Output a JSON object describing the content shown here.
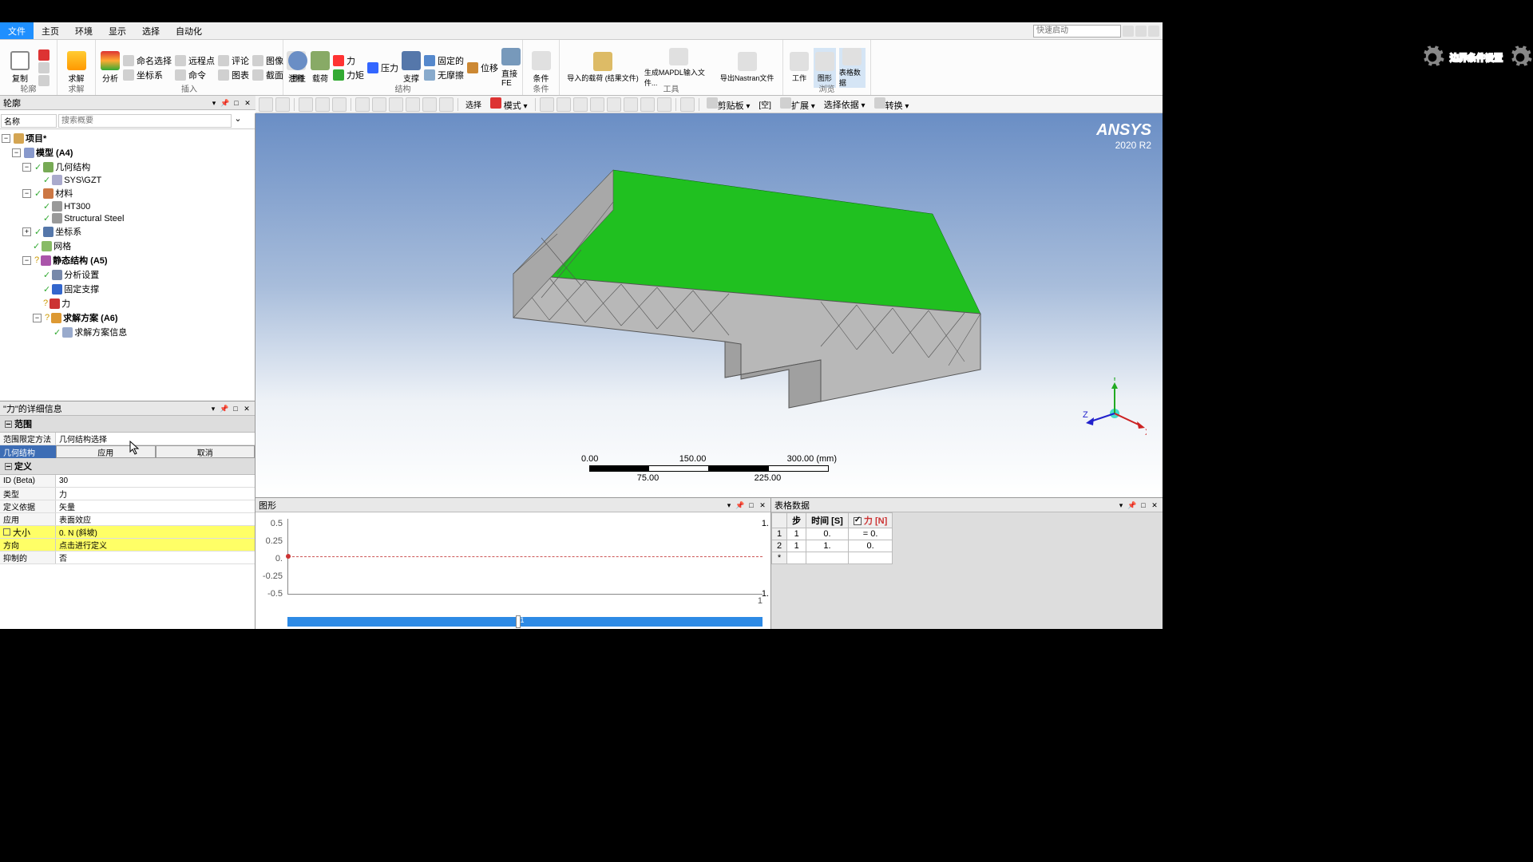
{
  "menubar": {
    "file": "文件",
    "home": "主页",
    "env": "环境",
    "display": "显示",
    "select": "选择",
    "auto": "自动化"
  },
  "quick": {
    "placeholder": "快速启动"
  },
  "ribbon": {
    "g1": {
      "copy": "复制",
      "label": "轮廓"
    },
    "g2": {
      "solve": "求解",
      "label": "求解"
    },
    "g3": {
      "analyze": "分析",
      "name_sel": "命名选择",
      "remote_pt": "远程点",
      "comment": "评论",
      "image": "图像",
      "coord": "坐标系",
      "cmd": "命令",
      "chart": "图表",
      "section": "截面",
      "annot": "注释",
      "label": "插入"
    },
    "g4": {
      "inertia": "惯性",
      "load": "载荷",
      "force": "力",
      "pressure": "压力",
      "moment": "力矩",
      "support": "支撑",
      "fixed": "固定的",
      "disp": "位移",
      "frictionless": "无摩擦",
      "direct": "直接FE",
      "label": "结构"
    },
    "g5": {
      "cond": "条件",
      "label": "条件"
    },
    "g6": {
      "import": "导入的载荷 (结果文件)",
      "mapdl": "生成MAPDL输入文件...",
      "nastran": "导出Nastran文件",
      "label": "工具"
    },
    "g7": {
      "sheet": "工作",
      "shape": "图形",
      "table": "表格数据",
      "label": "浏览"
    }
  },
  "toolbar2": {
    "select": "选择",
    "mode": "模式",
    "clipboard": "剪贴板",
    "empty": "[空]",
    "extend": "扩展",
    "sel_dep": "选择依据",
    "convert": "转换"
  },
  "outline": {
    "title": "轮廓",
    "filter_name": "名称",
    "search_placeholder": "搜索概要",
    "project": "项目*",
    "model": "模型 (A4)",
    "geometry": "几何结构",
    "body": "SYS\\GZT",
    "materials": "材料",
    "ht300": "HT300",
    "steel": "Structural Steel",
    "coord": "坐标系",
    "mesh": "网格",
    "static": "静态结构 (A5)",
    "settings": "分析设置",
    "fixed_sup": "固定支撑",
    "force": "力",
    "solution": "求解方案 (A6)",
    "sol_info": "求解方案信息"
  },
  "details": {
    "title": "\"力\"的详细信息",
    "scope_hdr": "范围",
    "scope_method_lbl": "范围限定方法",
    "scope_method_val": "几何结构选择",
    "geometry_lbl": "几何结构",
    "apply_btn": "应用",
    "cancel_btn": "取消",
    "def_hdr": "定义",
    "id_lbl": "ID (Beta)",
    "id_val": "30",
    "type_lbl": "类型",
    "type_val": "力",
    "defby_lbl": "定义依据",
    "defby_val": "矢量",
    "applied_lbl": "应用",
    "applied_val": "表面效应",
    "mag_lbl": "大小",
    "mag_val": "0. N (斜坡)",
    "dir_lbl": "方向",
    "dir_val": "点击进行定义",
    "sup_lbl": "抑制的",
    "sup_val": "否"
  },
  "graph": {
    "title": "图形",
    "y": {
      "p05": "0.5",
      "p025": "0.25",
      "z": "0.",
      "n025": "-0.25",
      "n05": "-0.5"
    },
    "x": {
      "start": "",
      "end": "1"
    },
    "xr": {
      "top": "1.",
      "bot": "1."
    },
    "slider": "1"
  },
  "datapanel": {
    "title": "表格数据",
    "col_step": "步",
    "col_time": "时间 [S]",
    "col_force": "力 [N]",
    "r1": {
      "step": "1",
      "time": "0.",
      "force": "= 0."
    },
    "r2": {
      "step": "1",
      "time": "1.",
      "force": "0."
    },
    "star": "*"
  },
  "scale": {
    "v0": "0.00",
    "v1": "150.00",
    "v2": "300.00",
    "unit": "(mm)",
    "v75": "75.00",
    "v225": "225.00"
  },
  "ansys": {
    "name": "ANSYS",
    "ver": "2020 R2"
  },
  "axes": {
    "x": "X",
    "y": "Y",
    "z": "Z"
  },
  "watermark": "边界条件设置"
}
